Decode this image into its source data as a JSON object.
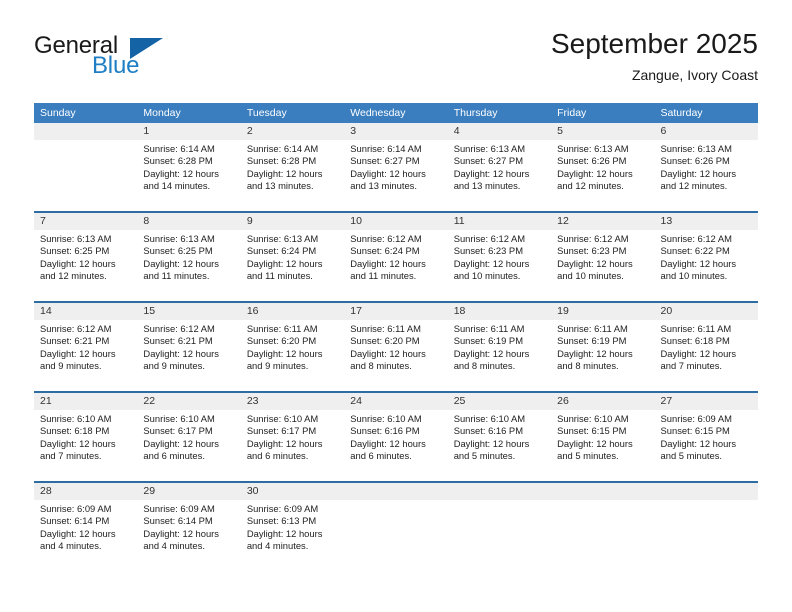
{
  "brand": {
    "name_part1": "General",
    "name_part2": "Blue",
    "logo_icon": "triangle-flag-icon"
  },
  "header": {
    "title": "September 2025",
    "subtitle": "Zangue, Ivory Coast"
  },
  "colors": {
    "header_blue": "#3a7ebf",
    "separator_blue": "#2e6da4",
    "daynum_band": "#efefef",
    "brand_blue": "#1f7ec4",
    "logo_blue": "#1464a5",
    "text": "#222222"
  },
  "weekdays": [
    "Sunday",
    "Monday",
    "Tuesday",
    "Wednesday",
    "Thursday",
    "Friday",
    "Saturday"
  ],
  "weeks": [
    {
      "days": [
        {
          "num": "",
          "lines": []
        },
        {
          "num": "1",
          "lines": [
            "Sunrise: 6:14 AM",
            "Sunset: 6:28 PM",
            "Daylight: 12 hours",
            "and 14 minutes."
          ]
        },
        {
          "num": "2",
          "lines": [
            "Sunrise: 6:14 AM",
            "Sunset: 6:28 PM",
            "Daylight: 12 hours",
            "and 13 minutes."
          ]
        },
        {
          "num": "3",
          "lines": [
            "Sunrise: 6:14 AM",
            "Sunset: 6:27 PM",
            "Daylight: 12 hours",
            "and 13 minutes."
          ]
        },
        {
          "num": "4",
          "lines": [
            "Sunrise: 6:13 AM",
            "Sunset: 6:27 PM",
            "Daylight: 12 hours",
            "and 13 minutes."
          ]
        },
        {
          "num": "5",
          "lines": [
            "Sunrise: 6:13 AM",
            "Sunset: 6:26 PM",
            "Daylight: 12 hours",
            "and 12 minutes."
          ]
        },
        {
          "num": "6",
          "lines": [
            "Sunrise: 6:13 AM",
            "Sunset: 6:26 PM",
            "Daylight: 12 hours",
            "and 12 minutes."
          ]
        }
      ]
    },
    {
      "days": [
        {
          "num": "7",
          "lines": [
            "Sunrise: 6:13 AM",
            "Sunset: 6:25 PM",
            "Daylight: 12 hours",
            "and 12 minutes."
          ]
        },
        {
          "num": "8",
          "lines": [
            "Sunrise: 6:13 AM",
            "Sunset: 6:25 PM",
            "Daylight: 12 hours",
            "and 11 minutes."
          ]
        },
        {
          "num": "9",
          "lines": [
            "Sunrise: 6:13 AM",
            "Sunset: 6:24 PM",
            "Daylight: 12 hours",
            "and 11 minutes."
          ]
        },
        {
          "num": "10",
          "lines": [
            "Sunrise: 6:12 AM",
            "Sunset: 6:24 PM",
            "Daylight: 12 hours",
            "and 11 minutes."
          ]
        },
        {
          "num": "11",
          "lines": [
            "Sunrise: 6:12 AM",
            "Sunset: 6:23 PM",
            "Daylight: 12 hours",
            "and 10 minutes."
          ]
        },
        {
          "num": "12",
          "lines": [
            "Sunrise: 6:12 AM",
            "Sunset: 6:23 PM",
            "Daylight: 12 hours",
            "and 10 minutes."
          ]
        },
        {
          "num": "13",
          "lines": [
            "Sunrise: 6:12 AM",
            "Sunset: 6:22 PM",
            "Daylight: 12 hours",
            "and 10 minutes."
          ]
        }
      ]
    },
    {
      "days": [
        {
          "num": "14",
          "lines": [
            "Sunrise: 6:12 AM",
            "Sunset: 6:21 PM",
            "Daylight: 12 hours",
            "and 9 minutes."
          ]
        },
        {
          "num": "15",
          "lines": [
            "Sunrise: 6:12 AM",
            "Sunset: 6:21 PM",
            "Daylight: 12 hours",
            "and 9 minutes."
          ]
        },
        {
          "num": "16",
          "lines": [
            "Sunrise: 6:11 AM",
            "Sunset: 6:20 PM",
            "Daylight: 12 hours",
            "and 9 minutes."
          ]
        },
        {
          "num": "17",
          "lines": [
            "Sunrise: 6:11 AM",
            "Sunset: 6:20 PM",
            "Daylight: 12 hours",
            "and 8 minutes."
          ]
        },
        {
          "num": "18",
          "lines": [
            "Sunrise: 6:11 AM",
            "Sunset: 6:19 PM",
            "Daylight: 12 hours",
            "and 8 minutes."
          ]
        },
        {
          "num": "19",
          "lines": [
            "Sunrise: 6:11 AM",
            "Sunset: 6:19 PM",
            "Daylight: 12 hours",
            "and 8 minutes."
          ]
        },
        {
          "num": "20",
          "lines": [
            "Sunrise: 6:11 AM",
            "Sunset: 6:18 PM",
            "Daylight: 12 hours",
            "and 7 minutes."
          ]
        }
      ]
    },
    {
      "days": [
        {
          "num": "21",
          "lines": [
            "Sunrise: 6:10 AM",
            "Sunset: 6:18 PM",
            "Daylight: 12 hours",
            "and 7 minutes."
          ]
        },
        {
          "num": "22",
          "lines": [
            "Sunrise: 6:10 AM",
            "Sunset: 6:17 PM",
            "Daylight: 12 hours",
            "and 6 minutes."
          ]
        },
        {
          "num": "23",
          "lines": [
            "Sunrise: 6:10 AM",
            "Sunset: 6:17 PM",
            "Daylight: 12 hours",
            "and 6 minutes."
          ]
        },
        {
          "num": "24",
          "lines": [
            "Sunrise: 6:10 AM",
            "Sunset: 6:16 PM",
            "Daylight: 12 hours",
            "and 6 minutes."
          ]
        },
        {
          "num": "25",
          "lines": [
            "Sunrise: 6:10 AM",
            "Sunset: 6:16 PM",
            "Daylight: 12 hours",
            "and 5 minutes."
          ]
        },
        {
          "num": "26",
          "lines": [
            "Sunrise: 6:10 AM",
            "Sunset: 6:15 PM",
            "Daylight: 12 hours",
            "and 5 minutes."
          ]
        },
        {
          "num": "27",
          "lines": [
            "Sunrise: 6:09 AM",
            "Sunset: 6:15 PM",
            "Daylight: 12 hours",
            "and 5 minutes."
          ]
        }
      ]
    },
    {
      "days": [
        {
          "num": "28",
          "lines": [
            "Sunrise: 6:09 AM",
            "Sunset: 6:14 PM",
            "Daylight: 12 hours",
            "and 4 minutes."
          ]
        },
        {
          "num": "29",
          "lines": [
            "Sunrise: 6:09 AM",
            "Sunset: 6:14 PM",
            "Daylight: 12 hours",
            "and 4 minutes."
          ]
        },
        {
          "num": "30",
          "lines": [
            "Sunrise: 6:09 AM",
            "Sunset: 6:13 PM",
            "Daylight: 12 hours",
            "and 4 minutes."
          ]
        },
        {
          "num": "",
          "lines": []
        },
        {
          "num": "",
          "lines": []
        },
        {
          "num": "",
          "lines": []
        },
        {
          "num": "",
          "lines": []
        }
      ]
    }
  ]
}
